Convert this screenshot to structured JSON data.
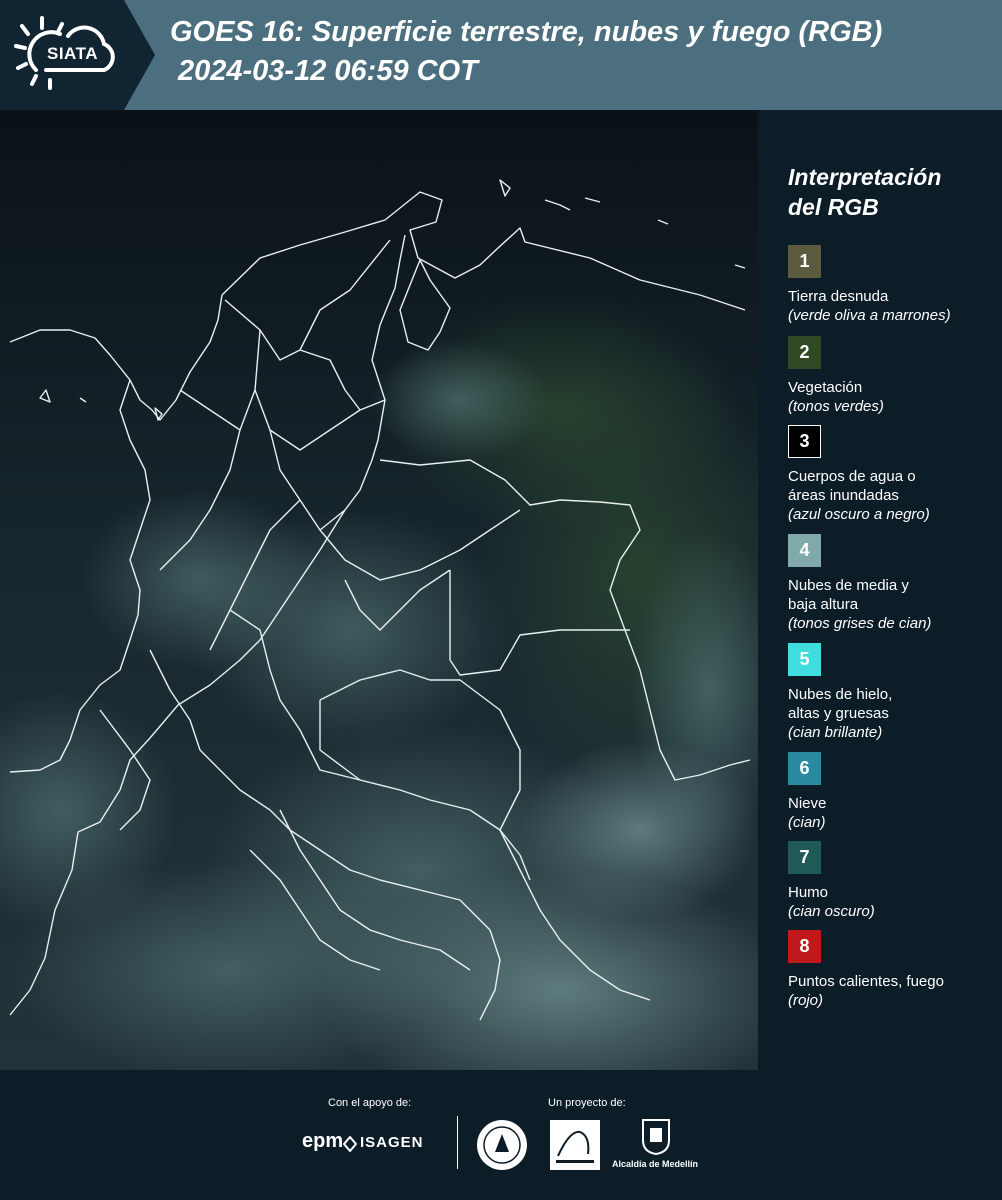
{
  "header": {
    "logo_text": "SIATA",
    "title": "GOES 16: Superficie terrestre, nubes y fuego (RGB)",
    "timestamp": "2024-03-12 06:59 COT"
  },
  "legend": {
    "title_line1": "Interpretación",
    "title_line2": "del RGB",
    "items": [
      {
        "number": "1",
        "color": "#5c5a3f",
        "label_lines": [
          "Tierra desnuda"
        ],
        "desc": "(verde oliva a marrones)"
      },
      {
        "number": "2",
        "color": "#2f4a24",
        "label_lines": [
          "Vegetación"
        ],
        "desc": "(tonos verdes)"
      },
      {
        "number": "3",
        "color": "#000000",
        "label_lines": [
          "Cuerpos de agua o",
          "áreas inundadas"
        ],
        "desc": "(azul oscuro a negro)"
      },
      {
        "number": "4",
        "color": "#82a9a9",
        "label_lines": [
          "Nubes de media y",
          "baja altura"
        ],
        "desc": "(tonos grises de cian)"
      },
      {
        "number": "5",
        "color": "#3fdddd",
        "label_lines": [
          "Nubes de hielo,",
          "altas y gruesas"
        ],
        "desc": "(cian brillante)"
      },
      {
        "number": "6",
        "color": "#2a8ba0",
        "label_lines": [
          "Nieve"
        ],
        "desc": "(cian)"
      },
      {
        "number": "7",
        "color": "#1f5a58",
        "label_lines": [
          "Humo"
        ],
        "desc": "(cian oscuro)"
      },
      {
        "number": "8",
        "color": "#c0191c",
        "label_lines": [
          "Puntos calientes, fuego"
        ],
        "desc": "(rojo)"
      }
    ]
  },
  "footer": {
    "support_label": "Con el apoyo de:",
    "project_label": "Un proyecto de:",
    "sponsors": [
      "epm",
      "ISAGEN"
    ],
    "partners": [
      "Área Metropolitana",
      "Alcaldía de Medellín"
    ],
    "partner_caption": "Alcaldía de Medellín"
  },
  "colors": {
    "header_bg": "#4b6f7f",
    "page_bg": "#0c1d28",
    "map_base": "#15232b"
  }
}
